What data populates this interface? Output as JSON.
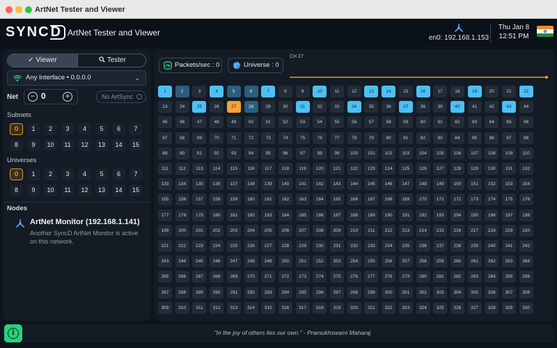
{
  "window": {
    "title": "ArtNet Tester and Viewer"
  },
  "header": {
    "logo_text": "SYNC",
    "logo_d": "D",
    "app_title": "ArtNet Tester and Viewer",
    "network": "en0: 192.168.1.153",
    "date": "Thu Jan 8",
    "time": "12:51 PM",
    "flag_icon": "india-flag-icon"
  },
  "sidebar": {
    "mode_tabs": {
      "viewer": "Viewer",
      "tester": "Tester",
      "active": "viewer"
    },
    "interface": "Any Interface • 0.0.0.0",
    "net": {
      "label": "Net",
      "value": "0"
    },
    "artsync": "No ArtSync",
    "subnets": {
      "label": "Subnets",
      "values": [
        "0",
        "1",
        "2",
        "3",
        "4",
        "5",
        "6",
        "7",
        "8",
        "9",
        "10",
        "11",
        "12",
        "13",
        "14",
        "15"
      ],
      "active": "0"
    },
    "universes": {
      "label": "Universes",
      "values": [
        "0",
        "1",
        "2",
        "3",
        "4",
        "5",
        "6",
        "7",
        "8",
        "9",
        "10",
        "11",
        "12",
        "13",
        "14",
        "15"
      ],
      "active": "0"
    },
    "nodes": {
      "label": "Nodes",
      "items": [
        {
          "name": "ArtNet Monitor (192.168.1.141)",
          "desc": "Another SyncD ArtNet Monitor is active on this network."
        }
      ]
    }
  },
  "main": {
    "packets_label": "Packets/sec : 0",
    "universe_label": "Universe : 0",
    "channel_label": "CH 27",
    "channel_graph_value": 0,
    "channels": {
      "count": 330,
      "high": [
        1,
        4,
        7,
        10,
        13,
        14,
        16,
        19,
        22,
        25,
        31,
        34,
        37,
        40,
        43
      ],
      "mid": [
        2,
        5,
        6,
        28
      ],
      "selected": 27
    }
  },
  "footer": {
    "info_icon": "info-icon",
    "quote": "\"In the joy of others lies our own.\" - Pramukhswami Maharaj"
  },
  "colors": {
    "accent_orange": "#f4a23a",
    "channel_active": "#4cc0f5",
    "info_green": "#2ad07a"
  }
}
